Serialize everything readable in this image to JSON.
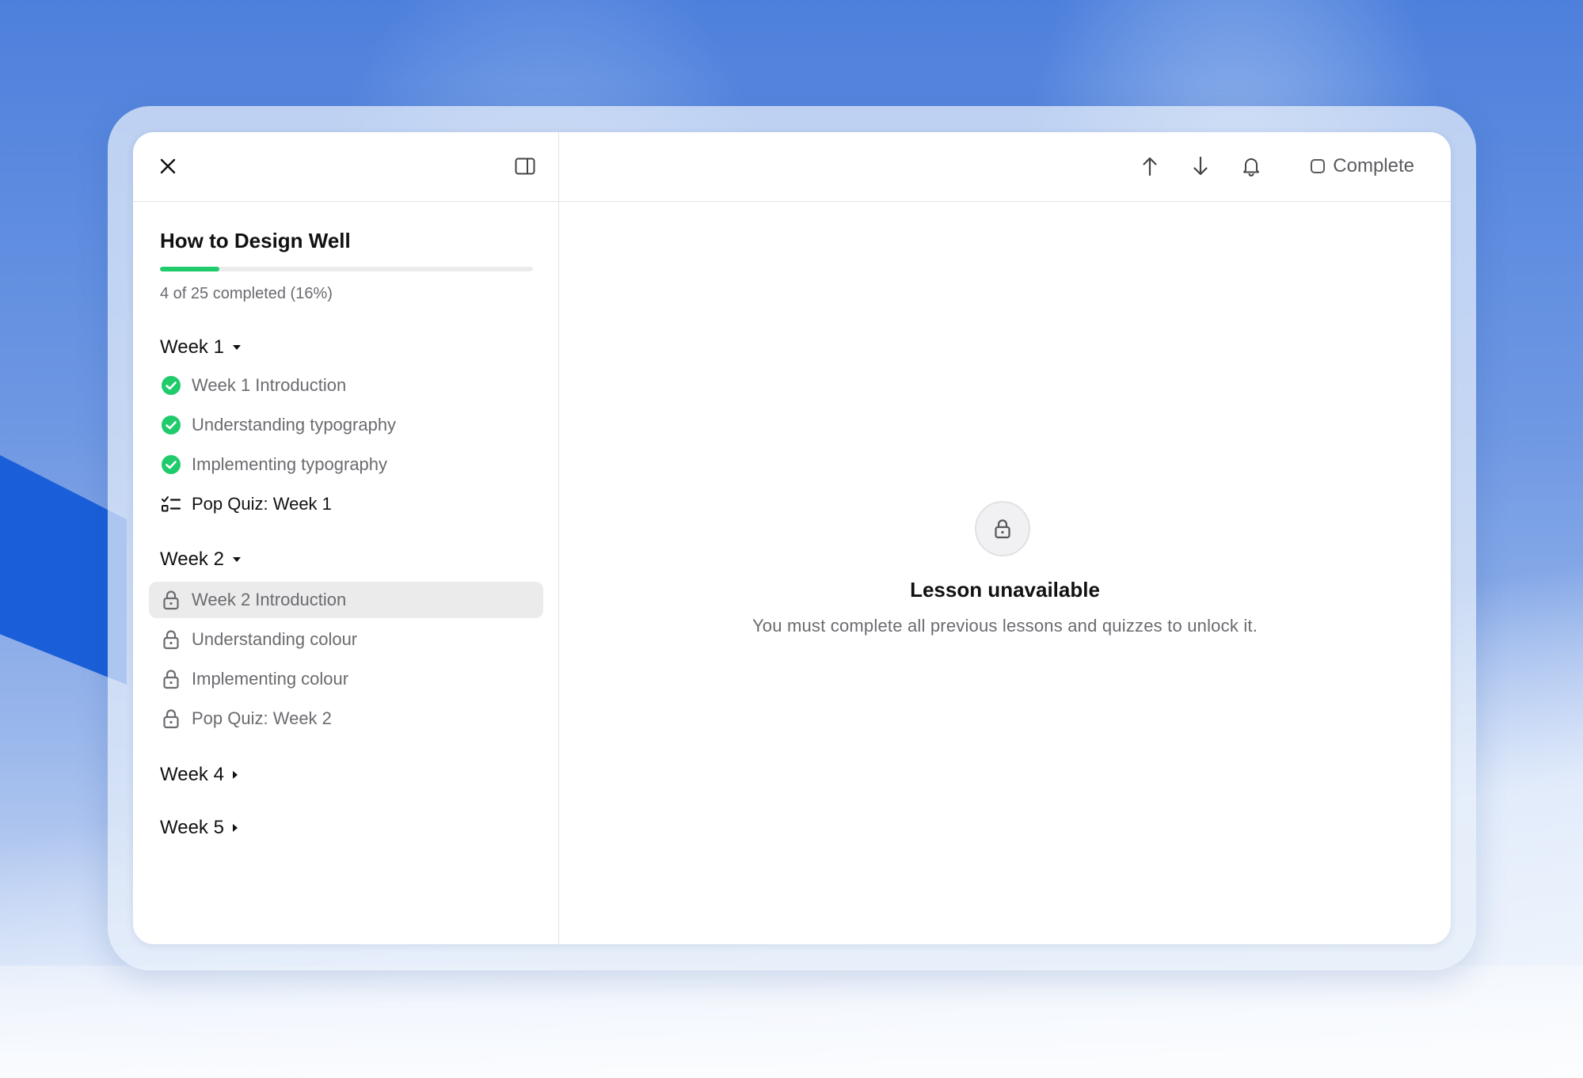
{
  "course": {
    "title": "How to Design Well",
    "progress_fraction": 0.16,
    "progress_text": "4 of 25 completed (16%)"
  },
  "sidebar": {
    "close_icon": "close-icon",
    "toggle_icon": "sidebar-toggle-icon"
  },
  "weeks": [
    {
      "label": "Week 1",
      "expanded": true,
      "lessons": [
        {
          "label": "Week 1 Introduction",
          "status": "completed",
          "icon": "check-circle-icon"
        },
        {
          "label": "Understanding typography",
          "status": "completed",
          "icon": "check-circle-icon"
        },
        {
          "label": "Implementing typography",
          "status": "completed",
          "icon": "check-circle-icon"
        },
        {
          "label": "Pop Quiz: Week 1",
          "status": "quiz",
          "icon": "quiz-list-icon"
        }
      ]
    },
    {
      "label": "Week 2",
      "expanded": true,
      "lessons": [
        {
          "label": "Week 2 Introduction",
          "status": "locked",
          "icon": "lock-icon",
          "selected": true
        },
        {
          "label": "Understanding colour",
          "status": "locked",
          "icon": "lock-icon"
        },
        {
          "label": "Implementing colour",
          "status": "locked",
          "icon": "lock-icon"
        },
        {
          "label": "Pop Quiz: Week 2",
          "status": "locked",
          "icon": "lock-icon"
        }
      ]
    },
    {
      "label": "Week 4",
      "expanded": false
    },
    {
      "label": "Week 5",
      "expanded": false
    }
  ],
  "toolbar": {
    "prev_icon": "arrow-up-icon",
    "next_icon": "arrow-down-icon",
    "notify_icon": "bell-icon",
    "complete_label": "Complete"
  },
  "empty_state": {
    "icon": "lock-icon",
    "title": "Lesson unavailable",
    "description": "You must complete all previous lessons and quizzes to unlock it."
  },
  "colors": {
    "progress": "#1fcb6b",
    "check": "#1fcb6b",
    "selected_bg": "#ebebec",
    "accent_blue": "#1a5fd9"
  }
}
